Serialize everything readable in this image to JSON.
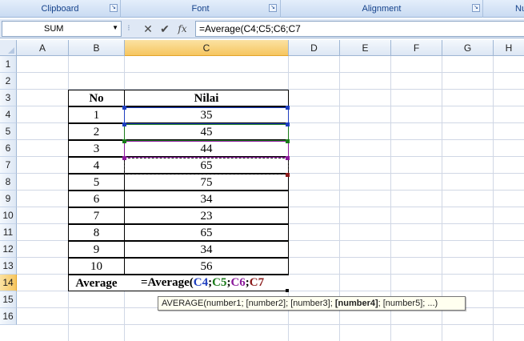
{
  "ribbon": {
    "groups": [
      {
        "label": "Clipboard"
      },
      {
        "label": "Font"
      },
      {
        "label": "Alignment"
      },
      {
        "label": "Nu"
      }
    ]
  },
  "formula_bar": {
    "name_box": "SUM",
    "cancel_icon": "close-icon",
    "enter_icon": "checkmark-icon",
    "fx_label": "fx",
    "formula": "=Average(C4;C5;C6;C7"
  },
  "columns": [
    "A",
    "B",
    "C",
    "D",
    "E",
    "F",
    "G",
    "H"
  ],
  "rows": [
    "1",
    "2",
    "3",
    "4",
    "5",
    "6",
    "7",
    "8",
    "9",
    "10",
    "11",
    "12",
    "13",
    "14",
    "15",
    "16"
  ],
  "active_column": "C",
  "active_row": "14",
  "table": {
    "headers": [
      "No",
      "Nilai"
    ],
    "rows": [
      {
        "no": "1",
        "nilai": "35"
      },
      {
        "no": "2",
        "nilai": "45"
      },
      {
        "no": "3",
        "nilai": "44"
      },
      {
        "no": "4",
        "nilai": "65"
      },
      {
        "no": "5",
        "nilai": "75"
      },
      {
        "no": "6",
        "nilai": "34"
      },
      {
        "no": "7",
        "nilai": "23"
      },
      {
        "no": "8",
        "nilai": "65"
      },
      {
        "no": "9",
        "nilai": "34"
      },
      {
        "no": "10",
        "nilai": "56"
      }
    ],
    "average_label": "Average"
  },
  "editing_formula": {
    "prefix": "=Average(",
    "refs": [
      {
        "text": "C4",
        "color": "#1f3fbf"
      },
      {
        "text": "C5",
        "color": "#1a7a1a"
      },
      {
        "text": "C6",
        "color": "#8b1a9b"
      },
      {
        "text": "C7",
        "color": "#8b1a1a"
      }
    ],
    "separator": ";"
  },
  "tooltip": {
    "before": "AVERAGE(number1; [number2]; [number3]; ",
    "bold": "[number4]",
    "after": "; [number5]; ...)"
  },
  "colors": {
    "ribbon_text": "#15428b",
    "header_active": "#f6c660",
    "ref_c4": "#1f3fbf",
    "ref_c5": "#1a7a1a",
    "ref_c6": "#8b1a9b",
    "ref_c7": "#8b1a1a"
  }
}
